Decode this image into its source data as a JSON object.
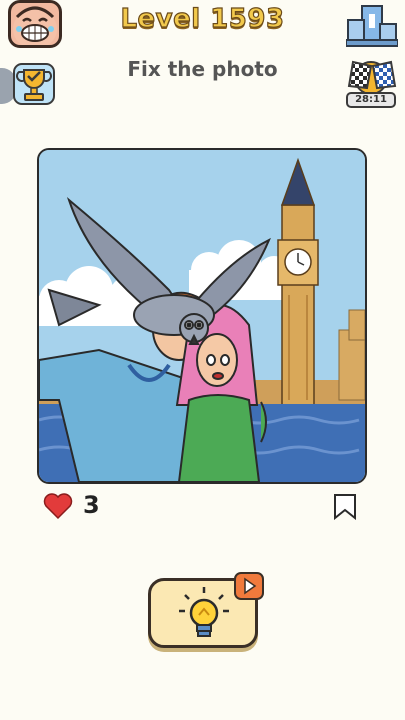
{
  "header": {
    "level_title": "Level 1593",
    "task_title": "Fix the photo",
    "race_time": "28:11"
  },
  "post": {
    "likes": "3"
  },
  "icons": {
    "avatar": "laughing-face-icon",
    "trophy": "trophy-icon",
    "podium": "podium-icon",
    "race": "checkered-flags-icon",
    "like": "heart-icon",
    "bookmark": "bookmark-icon",
    "hint": "lightbulb-icon",
    "video": "play-video-icon"
  },
  "colors": {
    "background": "#fdfcf4",
    "level_text": "#f2c94c",
    "heart": "#e23b3b",
    "hint_button": "#fbe8b3",
    "video_badge": "#f07a3c"
  }
}
